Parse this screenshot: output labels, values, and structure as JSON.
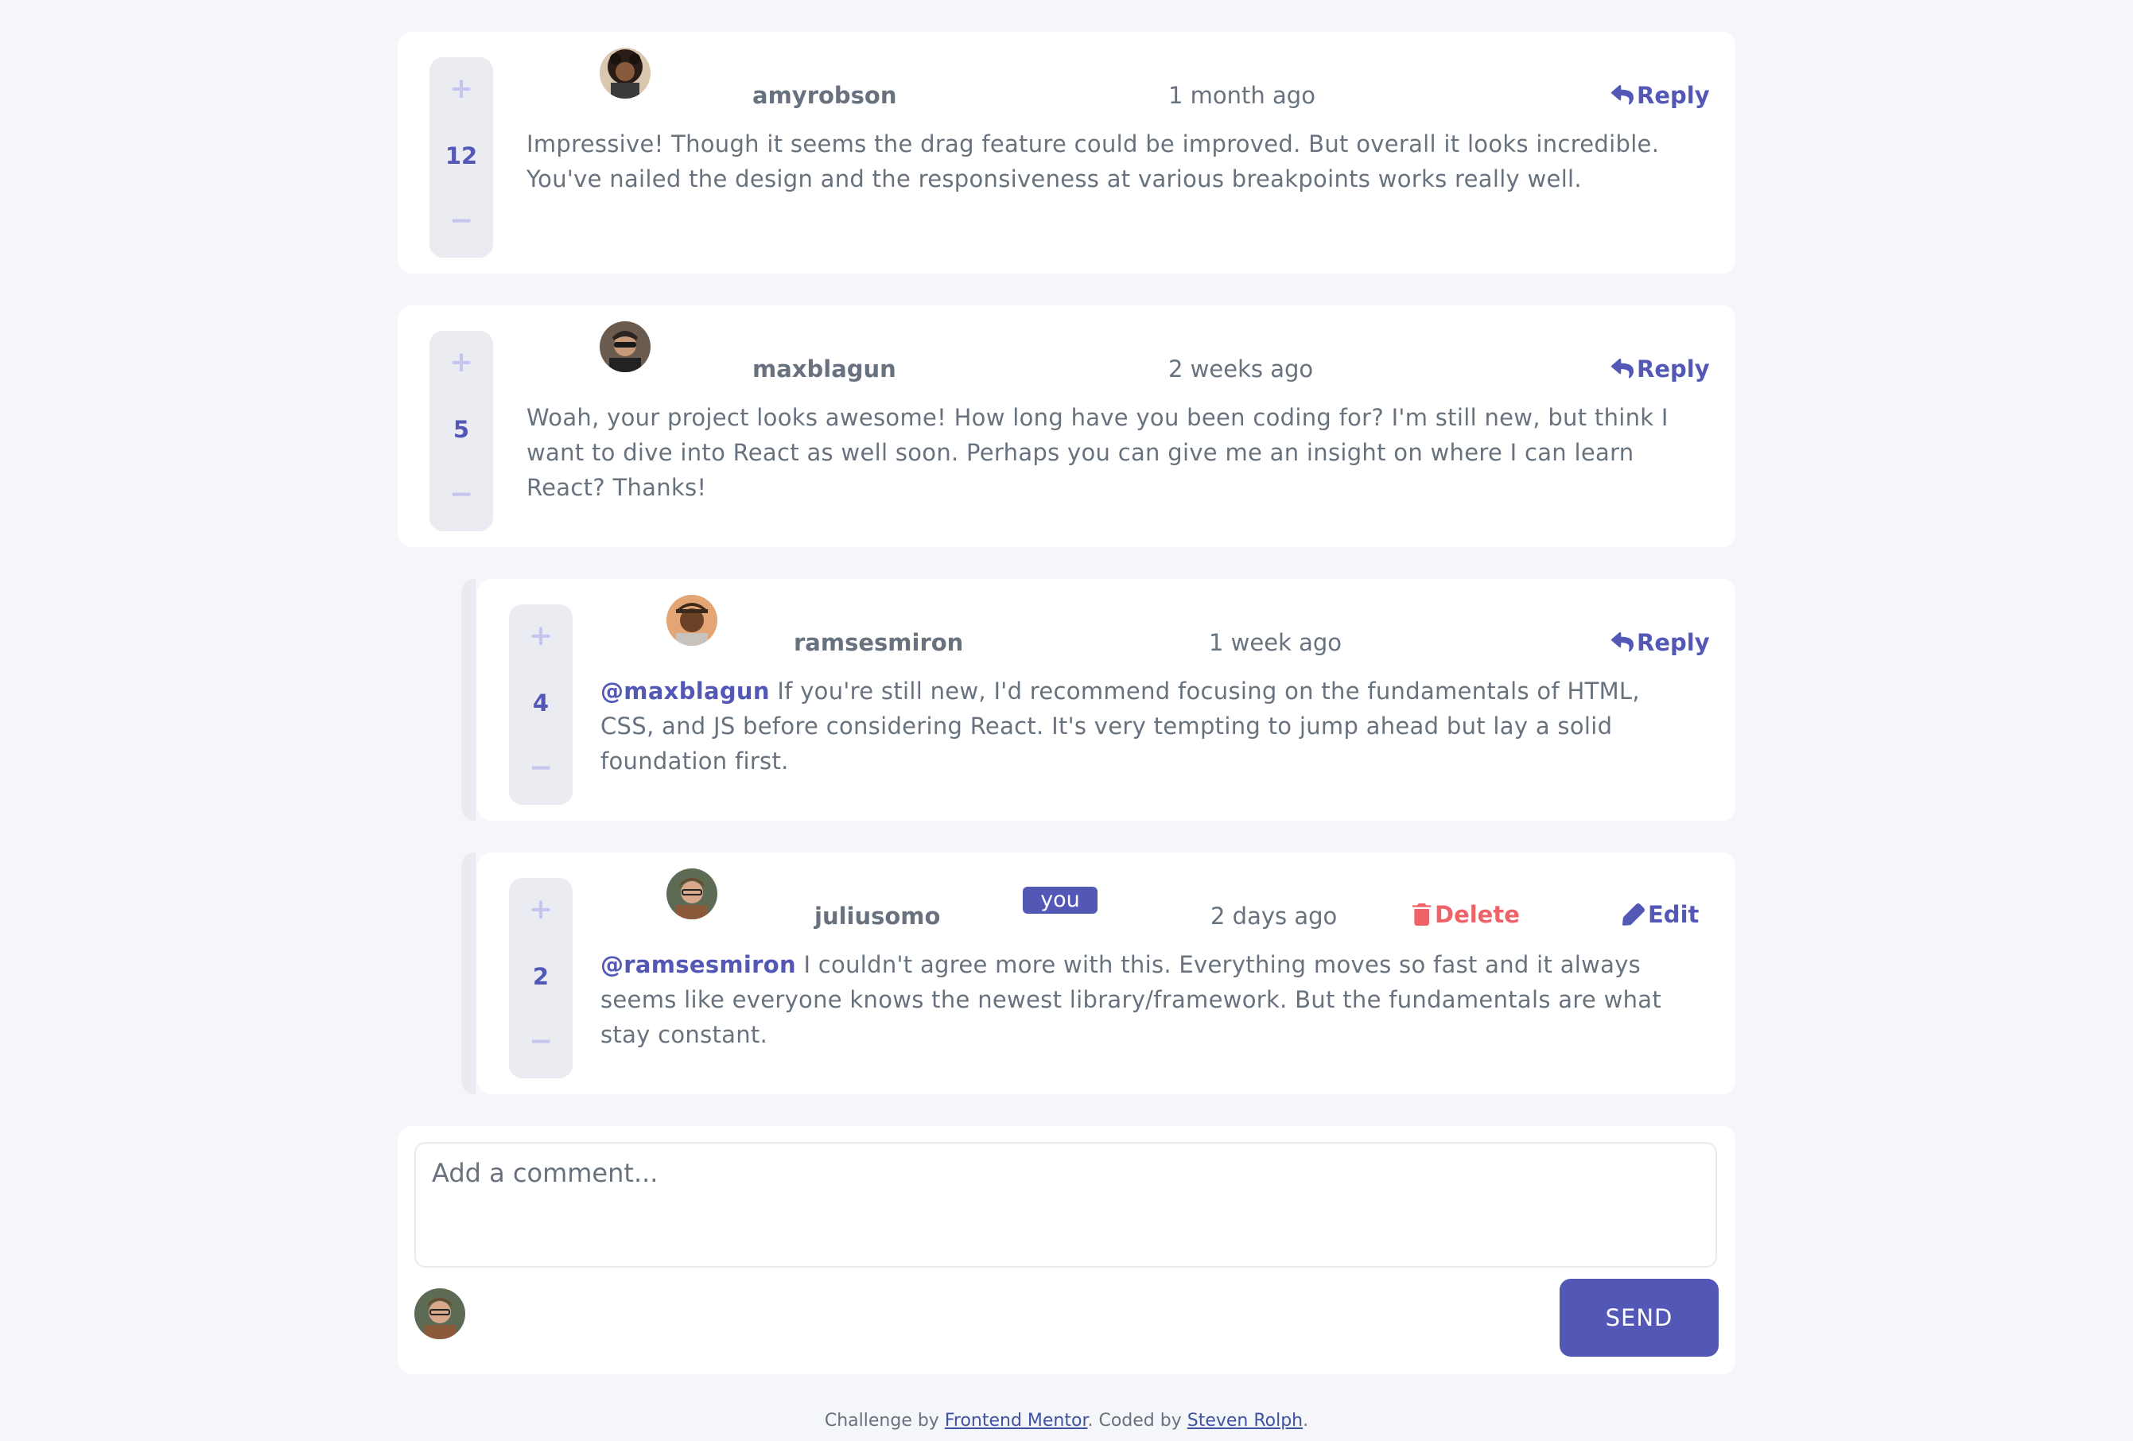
{
  "comments": [
    {
      "username": "amyrobson",
      "time": "1 month ago",
      "score": "12",
      "reply_label": "Reply",
      "text": "Impressive! Though it seems the drag feature could be improved. But overall it looks incredible. You've nailed the design and the responsiveness at various breakpoints works really well."
    },
    {
      "username": "maxblagun",
      "time": "2 weeks ago",
      "score": "5",
      "reply_label": "Reply",
      "text": "Woah, your project looks awesome! How long have you been coding for? I'm still new, but think I want to dive into React as well soon. Perhaps you can give me an insight on where I can learn React? Thanks!"
    }
  ],
  "replies": [
    {
      "username": "ramsesmiron",
      "time": "1 week ago",
      "score": "4",
      "reply_label": "Reply",
      "mention": "@maxblagun",
      "text": " If you're still new, I'd recommend focusing on the fundamentals of HTML, CSS, and JS before considering React. It's very tempting to jump ahead but lay a solid foundation first."
    },
    {
      "username": "juliusomo",
      "you_badge": "you",
      "time": "2 days ago",
      "score": "2",
      "delete_label": "Delete",
      "edit_label": "Edit",
      "mention": "@ramsesmiron",
      "text": " I couldn't agree more with this. Everything moves so fast and it always seems like everyone knows the newest library/framework. But the fundamentals are what stay constant."
    }
  ],
  "vote": {
    "plus": "+",
    "minus": "−"
  },
  "composer": {
    "placeholder": "Add a comment...",
    "send_label": "SEND"
  },
  "footer": {
    "prefix": "Challenge by ",
    "link1": "Frontend Mentor",
    "middle": ". Coded by ",
    "link2": "Steven Rolph",
    "suffix": "."
  },
  "colors": {
    "primary": "#5357b6",
    "danger": "#ed6368",
    "background": "#f5f6fa",
    "text": "#67727e"
  }
}
